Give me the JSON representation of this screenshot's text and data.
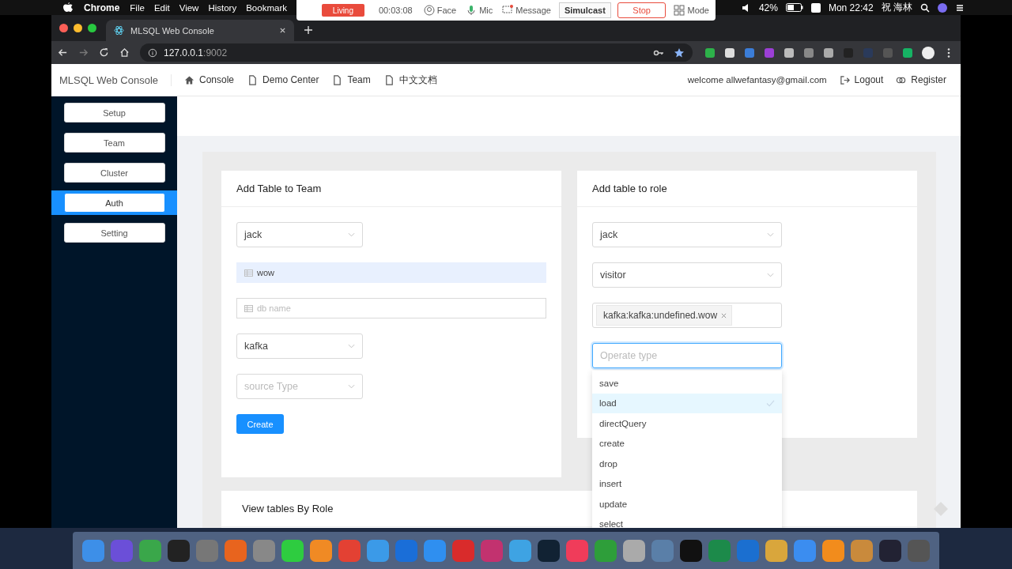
{
  "menu_bar": {
    "app": "Chrome",
    "menus": [
      "File",
      "Edit",
      "View",
      "History",
      "Bookmark"
    ],
    "battery": "42%",
    "clock": "Mon 22:42",
    "user": "祝 海林"
  },
  "recorder": {
    "status": "Living",
    "elapsed": "00:03:08",
    "face": "Face",
    "mic": "Mic",
    "message": "Message",
    "simulcast": "Simulcast",
    "stop": "Stop",
    "mode": "Mode"
  },
  "browser": {
    "tab_title": "MLSQL Web Console",
    "url_host": "127.0.0.1",
    "url_port": ":9002"
  },
  "navbar": {
    "brand": "MLSQL Web Console",
    "links": [
      {
        "label": "Console",
        "kind": "home"
      },
      {
        "label": "Demo Center",
        "kind": "doc"
      },
      {
        "label": "Team",
        "kind": "doc"
      },
      {
        "label": "中文文档",
        "kind": "doc"
      }
    ],
    "welcome": "welcome allwefantasy@gmail.com",
    "logout": "Logout",
    "register": "Register"
  },
  "sidebar": {
    "items": [
      {
        "label": "Setup",
        "selected": false
      },
      {
        "label": "Team",
        "selected": false
      },
      {
        "label": "Cluster",
        "selected": false
      },
      {
        "label": "Auth",
        "selected": true
      },
      {
        "label": "Setting",
        "selected": false
      }
    ]
  },
  "add_table_to_team": {
    "title": "Add Table to Team",
    "fields": [
      {
        "kind": "select",
        "value": "jack"
      },
      {
        "kind": "input",
        "value": "wow",
        "autofilled": true
      },
      {
        "kind": "input",
        "placeholder": "db name",
        "autofilled": false
      },
      {
        "kind": "select",
        "value": "kafka"
      },
      {
        "kind": "select",
        "placeholder": "source Type"
      }
    ],
    "button": "Create"
  },
  "add_table_to_role": {
    "title": "Add table to role",
    "fields": [
      {
        "kind": "select",
        "value": "jack"
      },
      {
        "kind": "select",
        "value": "visitor"
      },
      {
        "kind": "tags",
        "tags": [
          "kafka:kafka:undefined.wow"
        ]
      },
      {
        "kind": "select",
        "placeholder": "Operate type",
        "open": true,
        "options": [
          {
            "label": "save",
            "selected": false
          },
          {
            "label": "load",
            "selected": true
          },
          {
            "label": "directQuery",
            "selected": false
          },
          {
            "label": "create",
            "selected": false
          },
          {
            "label": "drop",
            "selected": false
          },
          {
            "label": "insert",
            "selected": false
          },
          {
            "label": "update",
            "selected": false
          },
          {
            "label": "select",
            "selected": false
          }
        ]
      }
    ]
  },
  "view_tables_by_role": {
    "title": "View tables By Role"
  }
}
